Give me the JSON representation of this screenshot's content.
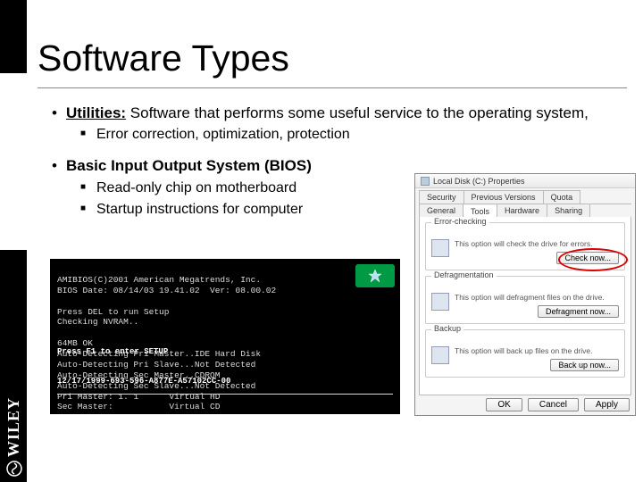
{
  "title": "Software Types",
  "bullets": {
    "utilities_label": "Utilities:",
    "utilities_text": " Software that performs some useful service to the operating system,",
    "utilities_sub": "Error correction, optimization, protection",
    "bios_label": "Basic Input Output System (BIOS)",
    "bios_sub1": "Read-only chip on motherboard",
    "bios_sub2": "Startup instructions for computer"
  },
  "bios_screen": {
    "line1": "AMIBIOS(C)2001 American Megatrends, Inc.",
    "line2": "BIOS Date: 08/14/03 19.41.02  Ver: 08.00.02",
    "line3": "Press DEL to run Setup",
    "line4": "Checking NVRAM..",
    "line5": "64MB OK",
    "line6": "Auto-Detecting Pri Master..IDE Hard Disk",
    "line7": "Auto-Detecting Pri Slave...Not Detected",
    "line8": "Auto-Detecting Sec Master..CDROM",
    "line9": "Auto-Detecting Sec Slave...Not Detected",
    "line10": "Pri Master: 1. 1      Virtual HD",
    "line11": "Sec Master:           Virtual CD",
    "foot": "Press F1 to enter SETUP",
    "foot2": "12/17/1999-693-596-A877E-A57102CC-00"
  },
  "dialog": {
    "title": "Local Disk (C:) Properties",
    "tabs_row1": [
      "Security",
      "Previous Versions",
      "Quota"
    ],
    "tabs_row2": [
      "General",
      "Tools",
      "Hardware",
      "Sharing"
    ],
    "group1": {
      "label": "Error-checking",
      "desc": "This option will check the drive for errors.",
      "button": "Check now..."
    },
    "group2": {
      "label": "Defragmentation",
      "desc": "This option will defragment files on the drive.",
      "button": "Defragment now..."
    },
    "group3": {
      "label": "Backup",
      "desc": "This option will back up files on the drive.",
      "button": "Back up now..."
    },
    "ok": "OK",
    "cancel": "Cancel",
    "apply": "Apply"
  },
  "brand": "WILEY"
}
